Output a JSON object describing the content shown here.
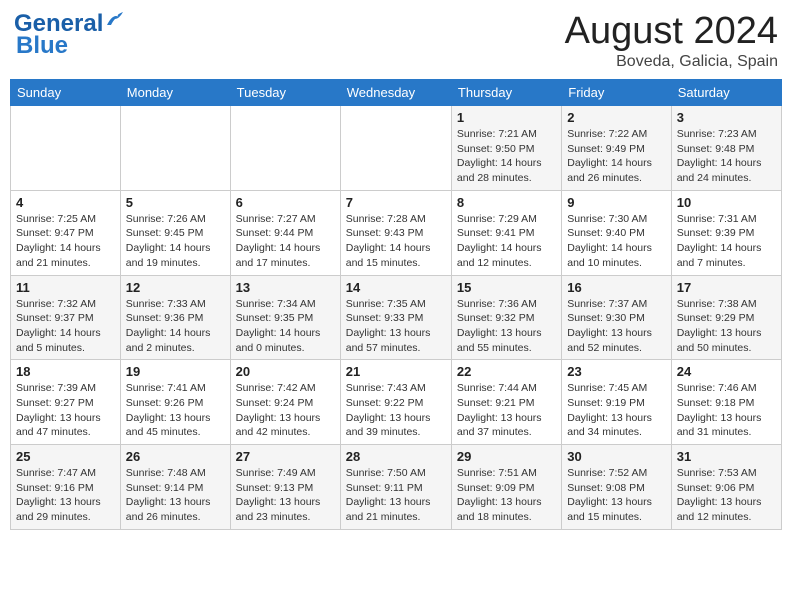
{
  "header": {
    "logo_general": "General",
    "logo_blue": "Blue",
    "month_year": "August 2024",
    "location": "Boveda, Galicia, Spain"
  },
  "days_of_week": [
    "Sunday",
    "Monday",
    "Tuesday",
    "Wednesday",
    "Thursday",
    "Friday",
    "Saturday"
  ],
  "weeks": [
    [
      {
        "day": "",
        "info": ""
      },
      {
        "day": "",
        "info": ""
      },
      {
        "day": "",
        "info": ""
      },
      {
        "day": "",
        "info": ""
      },
      {
        "day": "1",
        "sunrise": "7:21 AM",
        "sunset": "9:50 PM",
        "daylight": "14 hours and 28 minutes."
      },
      {
        "day": "2",
        "sunrise": "7:22 AM",
        "sunset": "9:49 PM",
        "daylight": "14 hours and 26 minutes."
      },
      {
        "day": "3",
        "sunrise": "7:23 AM",
        "sunset": "9:48 PM",
        "daylight": "14 hours and 24 minutes."
      }
    ],
    [
      {
        "day": "4",
        "sunrise": "7:25 AM",
        "sunset": "9:47 PM",
        "daylight": "14 hours and 21 minutes."
      },
      {
        "day": "5",
        "sunrise": "7:26 AM",
        "sunset": "9:45 PM",
        "daylight": "14 hours and 19 minutes."
      },
      {
        "day": "6",
        "sunrise": "7:27 AM",
        "sunset": "9:44 PM",
        "daylight": "14 hours and 17 minutes."
      },
      {
        "day": "7",
        "sunrise": "7:28 AM",
        "sunset": "9:43 PM",
        "daylight": "14 hours and 15 minutes."
      },
      {
        "day": "8",
        "sunrise": "7:29 AM",
        "sunset": "9:41 PM",
        "daylight": "14 hours and 12 minutes."
      },
      {
        "day": "9",
        "sunrise": "7:30 AM",
        "sunset": "9:40 PM",
        "daylight": "14 hours and 10 minutes."
      },
      {
        "day": "10",
        "sunrise": "7:31 AM",
        "sunset": "9:39 PM",
        "daylight": "14 hours and 7 minutes."
      }
    ],
    [
      {
        "day": "11",
        "sunrise": "7:32 AM",
        "sunset": "9:37 PM",
        "daylight": "14 hours and 5 minutes."
      },
      {
        "day": "12",
        "sunrise": "7:33 AM",
        "sunset": "9:36 PM",
        "daylight": "14 hours and 2 minutes."
      },
      {
        "day": "13",
        "sunrise": "7:34 AM",
        "sunset": "9:35 PM",
        "daylight": "14 hours and 0 minutes."
      },
      {
        "day": "14",
        "sunrise": "7:35 AM",
        "sunset": "9:33 PM",
        "daylight": "13 hours and 57 minutes."
      },
      {
        "day": "15",
        "sunrise": "7:36 AM",
        "sunset": "9:32 PM",
        "daylight": "13 hours and 55 minutes."
      },
      {
        "day": "16",
        "sunrise": "7:37 AM",
        "sunset": "9:30 PM",
        "daylight": "13 hours and 52 minutes."
      },
      {
        "day": "17",
        "sunrise": "7:38 AM",
        "sunset": "9:29 PM",
        "daylight": "13 hours and 50 minutes."
      }
    ],
    [
      {
        "day": "18",
        "sunrise": "7:39 AM",
        "sunset": "9:27 PM",
        "daylight": "13 hours and 47 minutes."
      },
      {
        "day": "19",
        "sunrise": "7:41 AM",
        "sunset": "9:26 PM",
        "daylight": "13 hours and 45 minutes."
      },
      {
        "day": "20",
        "sunrise": "7:42 AM",
        "sunset": "9:24 PM",
        "daylight": "13 hours and 42 minutes."
      },
      {
        "day": "21",
        "sunrise": "7:43 AM",
        "sunset": "9:22 PM",
        "daylight": "13 hours and 39 minutes."
      },
      {
        "day": "22",
        "sunrise": "7:44 AM",
        "sunset": "9:21 PM",
        "daylight": "13 hours and 37 minutes."
      },
      {
        "day": "23",
        "sunrise": "7:45 AM",
        "sunset": "9:19 PM",
        "daylight": "13 hours and 34 minutes."
      },
      {
        "day": "24",
        "sunrise": "7:46 AM",
        "sunset": "9:18 PM",
        "daylight": "13 hours and 31 minutes."
      }
    ],
    [
      {
        "day": "25",
        "sunrise": "7:47 AM",
        "sunset": "9:16 PM",
        "daylight": "13 hours and 29 minutes."
      },
      {
        "day": "26",
        "sunrise": "7:48 AM",
        "sunset": "9:14 PM",
        "daylight": "13 hours and 26 minutes."
      },
      {
        "day": "27",
        "sunrise": "7:49 AM",
        "sunset": "9:13 PM",
        "daylight": "13 hours and 23 minutes."
      },
      {
        "day": "28",
        "sunrise": "7:50 AM",
        "sunset": "9:11 PM",
        "daylight": "13 hours and 21 minutes."
      },
      {
        "day": "29",
        "sunrise": "7:51 AM",
        "sunset": "9:09 PM",
        "daylight": "13 hours and 18 minutes."
      },
      {
        "day": "30",
        "sunrise": "7:52 AM",
        "sunset": "9:08 PM",
        "daylight": "13 hours and 15 minutes."
      },
      {
        "day": "31",
        "sunrise": "7:53 AM",
        "sunset": "9:06 PM",
        "daylight": "13 hours and 12 minutes."
      }
    ]
  ],
  "labels": {
    "sunrise": "Sunrise:",
    "sunset": "Sunset:",
    "daylight": "Daylight:"
  }
}
